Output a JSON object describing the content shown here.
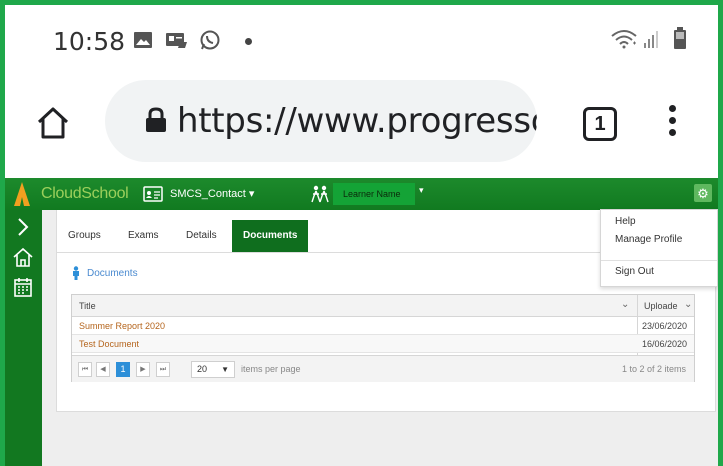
{
  "status_bar": {
    "time": "10:58"
  },
  "browser": {
    "url": "https://www.progresso.net/h",
    "tab_count": "1"
  },
  "app": {
    "logo_text": "CloudSchool",
    "contact_name": "SMCS_Contact ▾",
    "learner_name": "Learner Name",
    "colors": {
      "header_green": "#117a20",
      "active_tab": "#0f6e1e",
      "link_orange": "#b5651d",
      "section_blue": "#4a8ad0"
    }
  },
  "tabs": [
    {
      "label": "Groups",
      "active": false
    },
    {
      "label": "Exams",
      "active": false
    },
    {
      "label": "Details",
      "active": false
    },
    {
      "label": "Documents",
      "active": true
    }
  ],
  "documents": {
    "section_label": "Documents",
    "columns": {
      "title": "Title",
      "uploaded": "Uploade"
    },
    "rows": [
      {
        "name": "Summer Report 2020",
        "date": "23/06/2020"
      },
      {
        "name": "Test Document",
        "date": "16/06/2020"
      }
    ],
    "pager": {
      "current_page": "1",
      "page_size": "20",
      "items_per_page_label": "items per page",
      "info": "1 to 2 of 2 items"
    }
  },
  "menu": {
    "help": "Help",
    "manage_profile": "Manage Profile",
    "sign_out": "Sign Out"
  }
}
